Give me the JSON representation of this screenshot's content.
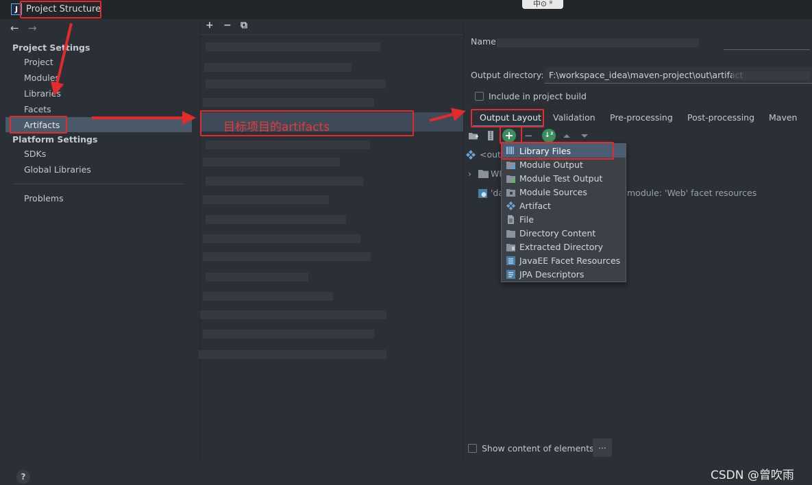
{
  "window": {
    "title": "Project Structure",
    "app_icon": "J",
    "top_widget": "中⊙ ⁸"
  },
  "nav": {
    "back_icon": "←",
    "forward_icon": "→",
    "project_settings": "Project Settings",
    "platform_settings": "Platform Settings",
    "items_project": [
      "Project",
      "Modules",
      "Libraries",
      "Facets",
      "Artifacts"
    ],
    "items_platform": [
      "SDKs",
      "Global Libraries"
    ],
    "problems": "Problems",
    "help": "?"
  },
  "middle": {
    "add": "+",
    "remove": "−",
    "copy": "⧉",
    "selected_label": "目标项目的artifacts"
  },
  "right": {
    "name_label": "Name",
    "output_dir_label": "Output directory:",
    "output_dir_value": "F:\\workspace_idea\\maven-project\\out\\artifact",
    "include_label": "Include in project build",
    "tabs": [
      "Output Layout",
      "Validation",
      "Pre-processing",
      "Post-processing",
      "Maven"
    ],
    "tree": {
      "root": "<outp",
      "folder": "WE",
      "resource_prefix": "'da",
      "resource_suffix": "module: 'Web' facet resources"
    },
    "show_content_label": "Show content of elements",
    "more_btn": "..."
  },
  "popup": {
    "items": [
      "Library Files",
      "Module Output",
      "Module Test Output",
      "Module Sources",
      "Artifact",
      "File",
      "Directory Content",
      "Extracted Directory",
      "JavaEE Facet Resources",
      "JPA Descriptors"
    ]
  },
  "watermark": "CSDN @曾吹雨"
}
